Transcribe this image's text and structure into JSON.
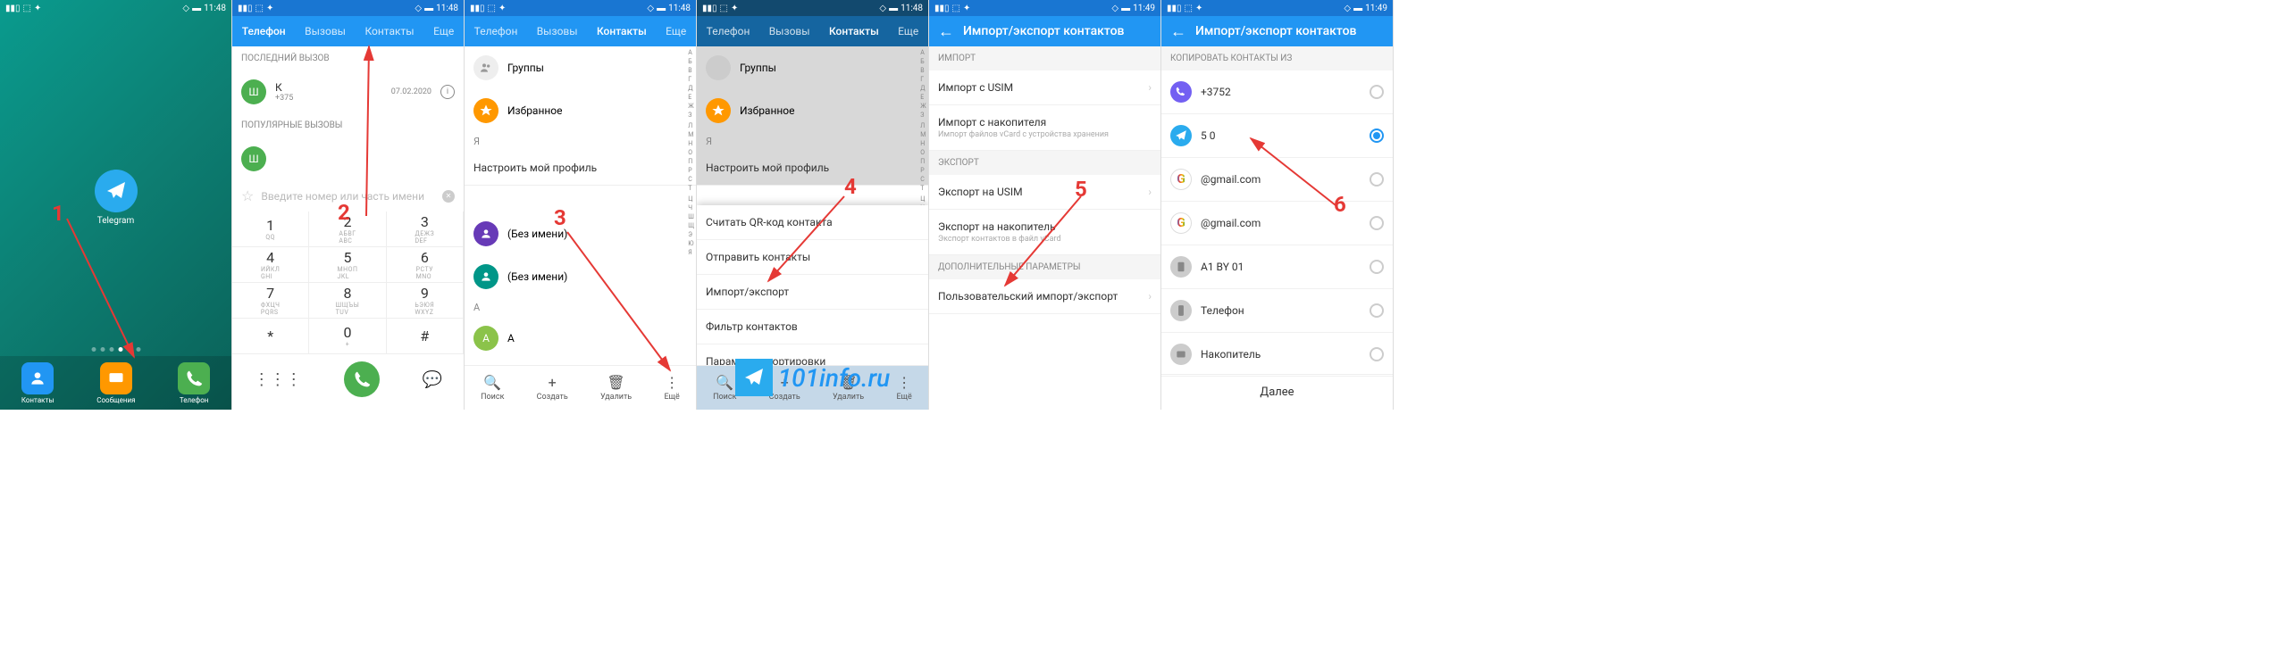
{
  "status": {
    "time1": "11:48",
    "time2": "11:49"
  },
  "panel1": {
    "telegram_label": "Telegram",
    "dock": {
      "contacts": "Контакты",
      "messages": "Сообщения",
      "phone": "Телефон"
    }
  },
  "tabs": {
    "phone": "Телефон",
    "calls": "Вызовы",
    "contacts": "Контакты",
    "more": "Еще"
  },
  "panel2": {
    "last_call": "ПОСЛЕДНИЙ ВЫЗОВ",
    "popular": "ПОПУЛЯРНЫЕ ВЫЗОВЫ",
    "contact_letter": "Ш",
    "contact_name": "К",
    "contact_num": "+375",
    "call_date": "07.02.2020",
    "search_placeholder": "Введите номер или часть имени",
    "keys": [
      {
        "n": "1",
        "s": "QQ"
      },
      {
        "n": "2",
        "s": "АБВГ\nABC"
      },
      {
        "n": "3",
        "s": "ДЕЖЗ\nDEF"
      },
      {
        "n": "4",
        "s": "ИЙКЛ\nGHI"
      },
      {
        "n": "5",
        "s": "МНОП\nJKL"
      },
      {
        "n": "6",
        "s": "РСТУ\nMNO"
      },
      {
        "n": "7",
        "s": "ФХЦЧ\nPQRS"
      },
      {
        "n": "8",
        "s": "ШЩЪЫ\nTUV"
      },
      {
        "n": "9",
        "s": "ЬЭЮЯ\nWXYZ"
      },
      {
        "n": "*",
        "s": ""
      },
      {
        "n": "0",
        "s": "+"
      },
      {
        "n": "#",
        "s": ""
      }
    ]
  },
  "panel3": {
    "groups": "Группы",
    "favorites": "Избранное",
    "letter_ya": "Я",
    "profile_setup": "Настроить мой профиль",
    "noname": "(Без имени)",
    "letter_a": "A",
    "contact_a": "A",
    "actions": {
      "search": "Поиск",
      "create": "Создать",
      "delete": "Удалить",
      "more": "Ещё"
    }
  },
  "panel4": {
    "menu": {
      "qr": "Считать QR-код контакта",
      "send": "Отправить контакты",
      "import": "Импорт/экспорт",
      "filter": "Фильтр контактов",
      "sort": "Параметры сортировки"
    }
  },
  "panel5": {
    "title": "Импорт/экспорт контактов",
    "import_h": "ИМПОРТ",
    "import_usim": "Импорт с  USIM",
    "import_storage": "Импорт с накопителя",
    "import_storage_sub": "Импорт файлов vCard с устройства хранения",
    "export_h": "ЭКСПОРТ",
    "export_usim": "Экспорт на  USIM",
    "export_storage": "Экспорт на накопитель",
    "export_storage_sub": "Экспорт контактов в файл vCard",
    "extra_h": "ДОПОЛНИТЕЛЬНЫЕ ПАРАМЕТРЫ",
    "custom": "Пользовательский импорт/экспорт"
  },
  "panel6": {
    "title": "Импорт/экспорт контактов",
    "copy_from": "КОПИРОВАТЬ КОНТАКТЫ ИЗ",
    "sources": [
      {
        "label": "+3752",
        "icon": "viber",
        "color": "#7360F2"
      },
      {
        "label": "5                0",
        "icon": "telegram",
        "color": "#2AABEE",
        "selected": true
      },
      {
        "label": "@gmail.com",
        "icon": "google",
        "color": "#fff"
      },
      {
        "label": "@gmail.com",
        "icon": "google",
        "color": "#fff"
      },
      {
        "label": "A1 BY 01",
        "icon": "sim",
        "color": "#ccc"
      },
      {
        "label": "Телефон",
        "icon": "phone",
        "color": "#ccc"
      },
      {
        "label": "Накопитель",
        "icon": "storage",
        "color": "#ccc"
      }
    ],
    "next": "Далее"
  },
  "alpha": [
    "А",
    "Б",
    "В",
    "Г",
    "Д",
    "Е",
    "Ж",
    "З",
    "",
    "Л",
    "М",
    "Н",
    "О",
    "П",
    "Р",
    "С",
    "Т",
    "",
    "Ц",
    "Ч",
    "Ш",
    "Щ",
    "Э",
    "Ю",
    "Я"
  ],
  "watermark": "101info.ru",
  "annotations": [
    "1",
    "2",
    "3",
    "4",
    "5",
    "6"
  ]
}
